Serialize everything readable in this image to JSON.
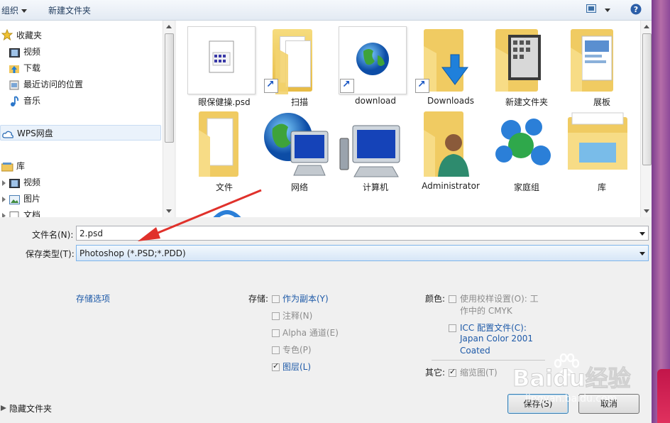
{
  "toolbar": {
    "organize": "组织",
    "new_folder": "新建文件夹"
  },
  "nav": {
    "favorites": "收藏夹",
    "items_fav": [
      "视频",
      "下载",
      "最近访问的位置",
      "音乐"
    ],
    "wps": "WPS网盘",
    "libraries": "库",
    "items_lib": [
      "视频",
      "图片",
      "文档"
    ]
  },
  "files": [
    {
      "name": "眼保健操.psd"
    },
    {
      "name": "扫描"
    },
    {
      "name": "download"
    },
    {
      "name": "Downloads"
    },
    {
      "name": "新建文件夹"
    },
    {
      "name": "展板"
    },
    {
      "name": "文件"
    },
    {
      "name": "网络"
    },
    {
      "name": "计算机"
    },
    {
      "name": "Administrator"
    },
    {
      "name": "家庭组"
    },
    {
      "name": "库"
    }
  ],
  "form": {
    "filename_label": "文件名(N):",
    "filename_value": "2.psd",
    "type_label": "保存类型(T):",
    "type_value": "Photoshop (*.PSD;*.PDD)"
  },
  "options": {
    "storage_options": "存储选项",
    "save_label": "存储:",
    "as_copy": "作为副本(Y)",
    "notes": "注释(N)",
    "alpha": "Alpha 通道(E)",
    "spot": "专色(P)",
    "layers": "图层(L)",
    "color_label": "颜色:",
    "proof_line1": "使用校样设置(O): 工",
    "proof_line2": "作中的 CMYK",
    "icc_line1": "ICC 配置文件(C):",
    "icc_line2": "Japan Color 2001",
    "icc_line3": "Coated",
    "other_label": "其它:",
    "thumbnail": "缩览图(T)"
  },
  "footer": {
    "hide_folders": "隐藏文件夹",
    "save": "保存(S)",
    "cancel": "取消"
  },
  "watermark": {
    "text": "Baidu经验",
    "sub": "jingyan.baidu.com"
  },
  "colors": {
    "accent": "#1e5aa8",
    "arrow": "#e0312b"
  }
}
